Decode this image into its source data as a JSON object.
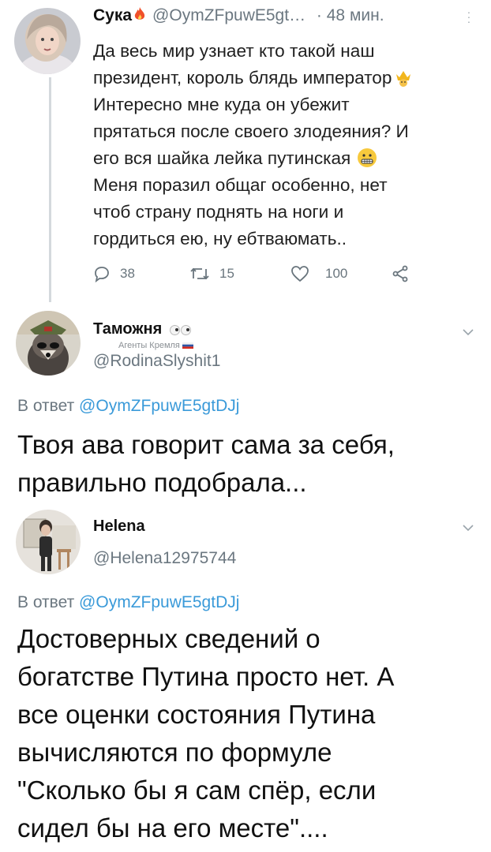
{
  "tweet1": {
    "name": "Сука",
    "handle": "@OymZFpuwE5gt…",
    "time": "· 48 мин.",
    "lines": [
      "Да весь мир узнает кто такой наш",
      "президент, король блядь император",
      "Интересно мне куда он убежит",
      "прятаться после своего злодеяния? И",
      "его вся шайка лейка путинская",
      "Меня поразил общаг особенно, нет",
      "чтоб страну поднять на ноги  и",
      "гордиться ею, ну ебтваюмать.."
    ],
    "replies": "38",
    "retweets": "15",
    "likes": "100",
    "icons": [
      "fire-icon",
      "crown-icon",
      "grimace-emoji-icon",
      "reply-icon",
      "retweet-icon",
      "like-icon",
      "share-icon",
      "more-icon"
    ]
  },
  "tweet2": {
    "name": "Таможня",
    "subtitle": "Агенты Кремля",
    "handle": "@RodinaSlyshit1",
    "in_reply_prefix": "В ответ",
    "in_reply_to": "@OymZFpuwE5gtDJj",
    "lines": [
      "Твоя ава говорит сама за себя,",
      "правильно подобрала..."
    ]
  },
  "tweet3": {
    "name": "Helena",
    "handle": "@Helena12975744",
    "in_reply_prefix": "В ответ",
    "in_reply_to": "@OymZFpuwE5gtDJj",
    "lines": [
      "Достоверных сведений о",
      "богатстве Путина просто нет. А",
      "все оценки состояния Путина",
      "вычисляются по формуле",
      "\"Сколько бы я сам спёр, если",
      "сидел бы на его месте\"...."
    ]
  },
  "colors": {
    "link": "#3a9ad9",
    "muted": "#6b7780",
    "thread": "#d4d9dd"
  }
}
